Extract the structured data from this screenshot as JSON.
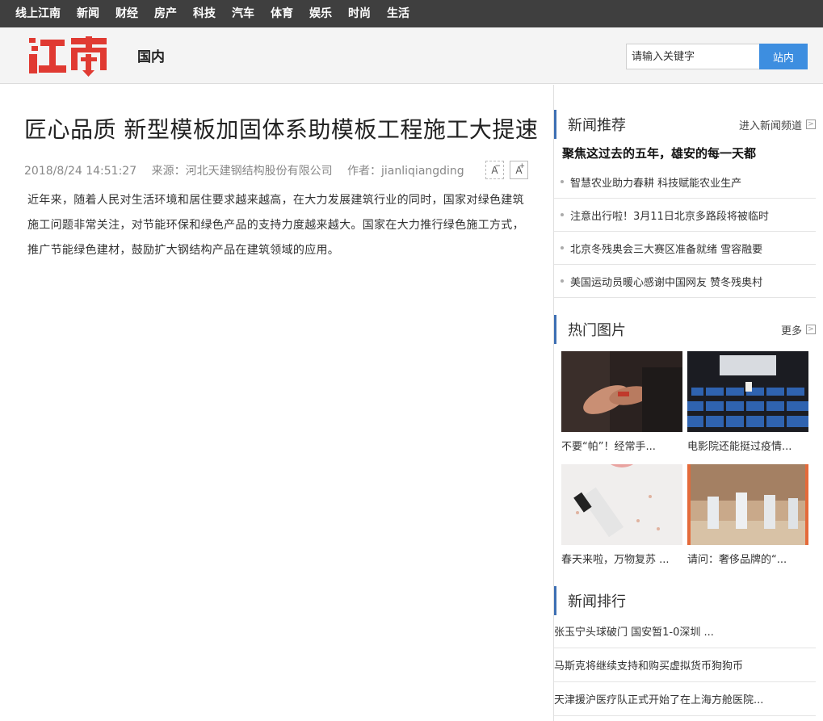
{
  "topnav": [
    "线上江南",
    "新闻",
    "财经",
    "房产",
    "科技",
    "汽车",
    "体育",
    "娱乐",
    "时尚",
    "生活"
  ],
  "header": {
    "logo_text": "江南",
    "section": "国内",
    "search_placeholder": "请输入关键字",
    "search_button": "站内"
  },
  "article": {
    "title": "匠心品质 新型模板加固体系助模板工程施工大提速",
    "date": "2018/8/24 14:51:27",
    "source": "来源：河北天建钢结构股份有限公司",
    "author": "作者：jianliqiangding",
    "font_minus": "A",
    "font_plus": "A",
    "body": "近年来，随着人民对生活环境和居住要求越来越高，在大力发展建筑行业的同时，国家对绿色建筑施工问题非常关注，对节能环保和绿色产品的支持力度越来越大。国家在大力推行绿色施工方式，推广节能绿色建材，鼓励扩大钢结构产品在建筑领域的应用。"
  },
  "sidebar": {
    "news_rec": {
      "title": "新闻推荐",
      "more": "进入新闻频道",
      "headline": "聚焦这过去的五年，雄安的每一天都",
      "items": [
        "智慧农业助力春耕 科技赋能农业生产",
        "注意出行啦！3月11日北京多路段将被临时",
        "北京冬残奥会三大赛区准备就绪 雪容融要",
        "美国运动员暖心感谢中国网友 赞冬残奥村"
      ]
    },
    "hot_pics": {
      "title": "热门图片",
      "more": "更多",
      "items": [
        "不要“帕”！经常手...",
        "电影院还能挺过疫情...",
        "春天来啦，万物复苏 ...",
        "请问：奢侈品牌的“..."
      ]
    },
    "ranking": {
      "title": "新闻排行",
      "items": [
        "张玉宁头球破门 国安暂1-0深圳 ...",
        "马斯克将继续支持和购买虚拟货币狗狗币",
        "天津援沪医疗队正式开始了在上海方舱医院..."
      ]
    }
  },
  "colors": {
    "accent": "#3d8ee0",
    "logo_red": "#e03a32",
    "nav_bg": "#3f3f3f"
  }
}
